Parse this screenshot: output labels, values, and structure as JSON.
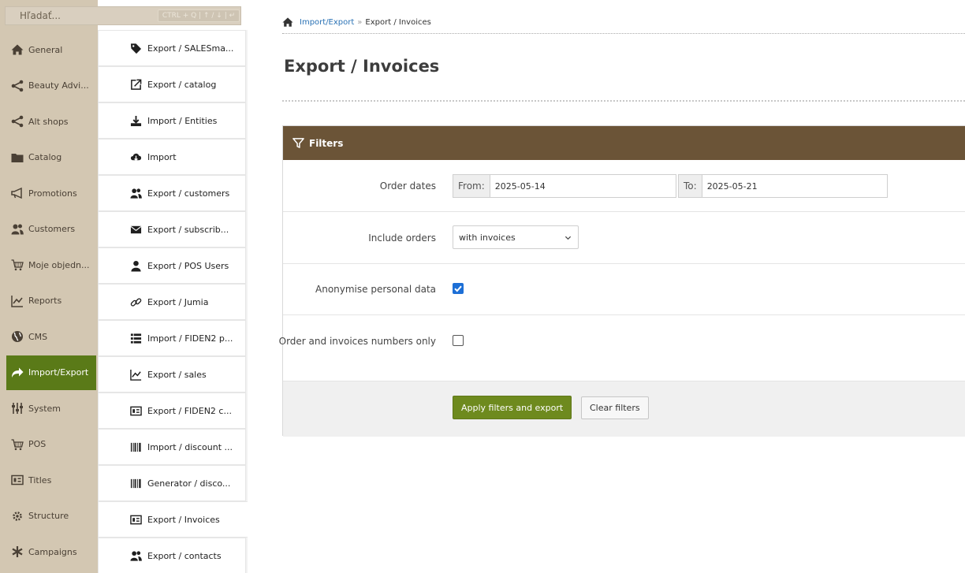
{
  "search": {
    "placeholder": "Hľadať...",
    "shortcut": "CTRL + Q | ↑ / ↓ | ↵"
  },
  "nav": {
    "items": [
      {
        "label": "General",
        "icon": "home-icon"
      },
      {
        "label": "Beauty Advi...",
        "icon": "share-icon"
      },
      {
        "label": "Alt shops",
        "icon": "share-icon"
      },
      {
        "label": "Catalog",
        "icon": "folder-icon"
      },
      {
        "label": "Promotions",
        "icon": "megaphone-icon"
      },
      {
        "label": "Customers",
        "icon": "users-icon"
      },
      {
        "label": "Moje objedn...",
        "icon": "cart-icon"
      },
      {
        "label": "Reports",
        "icon": "chart-icon"
      },
      {
        "label": "CMS",
        "icon": "globe-icon"
      },
      {
        "label": "Import/Export",
        "icon": "share-arrow-icon",
        "active": true
      },
      {
        "label": "System",
        "icon": "sliders-icon"
      },
      {
        "label": "POS",
        "icon": "cart-icon"
      },
      {
        "label": "Titles",
        "icon": "id-card-icon"
      },
      {
        "label": "Structure",
        "icon": "cogs-icon"
      },
      {
        "label": "Campaigns",
        "icon": "asterisk-icon"
      }
    ]
  },
  "subnav": {
    "items": [
      {
        "label": "Export / SALESma...",
        "icon": "tag-icon"
      },
      {
        "label": "Export / catalog",
        "icon": "external-link-icon"
      },
      {
        "label": "Import / Entities",
        "icon": "download-icon"
      },
      {
        "label": "Import",
        "icon": "cloud-download-icon"
      },
      {
        "label": "Export / customers",
        "icon": "users-icon"
      },
      {
        "label": "Export / subscrib...",
        "icon": "envelope-icon"
      },
      {
        "label": "Export / POS Users",
        "icon": "user-icon"
      },
      {
        "label": "Export / Jumia",
        "icon": "link-icon"
      },
      {
        "label": "Import / FIDEN2 p...",
        "icon": "list-icon"
      },
      {
        "label": "Export / sales",
        "icon": "chart-icon"
      },
      {
        "label": "Export / FIDEN2 c...",
        "icon": "id-card-icon"
      },
      {
        "label": "Import / discount ...",
        "icon": "barcode-icon"
      },
      {
        "label": "Generator / disco...",
        "icon": "barcode-icon"
      },
      {
        "label": "Export / Invoices",
        "icon": "id-card-icon",
        "active": true
      },
      {
        "label": "Export / contacts",
        "icon": "users-icon"
      }
    ]
  },
  "breadcrumb": {
    "parent": "Import/Export",
    "separator": "»",
    "current": "Export / Invoices"
  },
  "page": {
    "title": "Export / Invoices"
  },
  "filters": {
    "header": "Filters",
    "order_dates": {
      "label": "Order dates",
      "from_prefix": "From:",
      "from_value": "2025-05-14",
      "to_prefix": "To:",
      "to_value": "2025-05-21"
    },
    "include_orders": {
      "label": "Include orders",
      "value": "with invoices"
    },
    "anonymise": {
      "label": "Anonymise personal data",
      "checked": true
    },
    "numbers_only": {
      "label": "Order and invoices numbers only",
      "checked": false
    },
    "apply_label": "Apply filters and export",
    "clear_label": "Clear filters"
  },
  "colors": {
    "sidebar_bg": "#d3c7b2",
    "active_green": "#5a7a18",
    "panel_header": "#6b5437",
    "link_blue": "#2a72b5",
    "checkbox_blue": "#1d6fd6"
  }
}
